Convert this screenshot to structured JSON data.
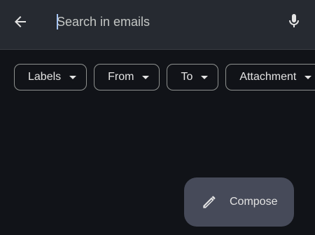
{
  "search": {
    "placeholder": "Search in emails",
    "value": ""
  },
  "icons": {
    "back": "arrow-left",
    "mic": "microphone",
    "compose": "pencil"
  },
  "filters": [
    {
      "label": "Labels"
    },
    {
      "label": "From"
    },
    {
      "label": "To"
    },
    {
      "label": "Attachment"
    }
  ],
  "compose": {
    "label": "Compose"
  },
  "colors": {
    "background": "#111318",
    "toolbar": "#262a31",
    "fab": "#464a59",
    "text": "#e3e3e3",
    "cursor": "#a8c7fa"
  }
}
